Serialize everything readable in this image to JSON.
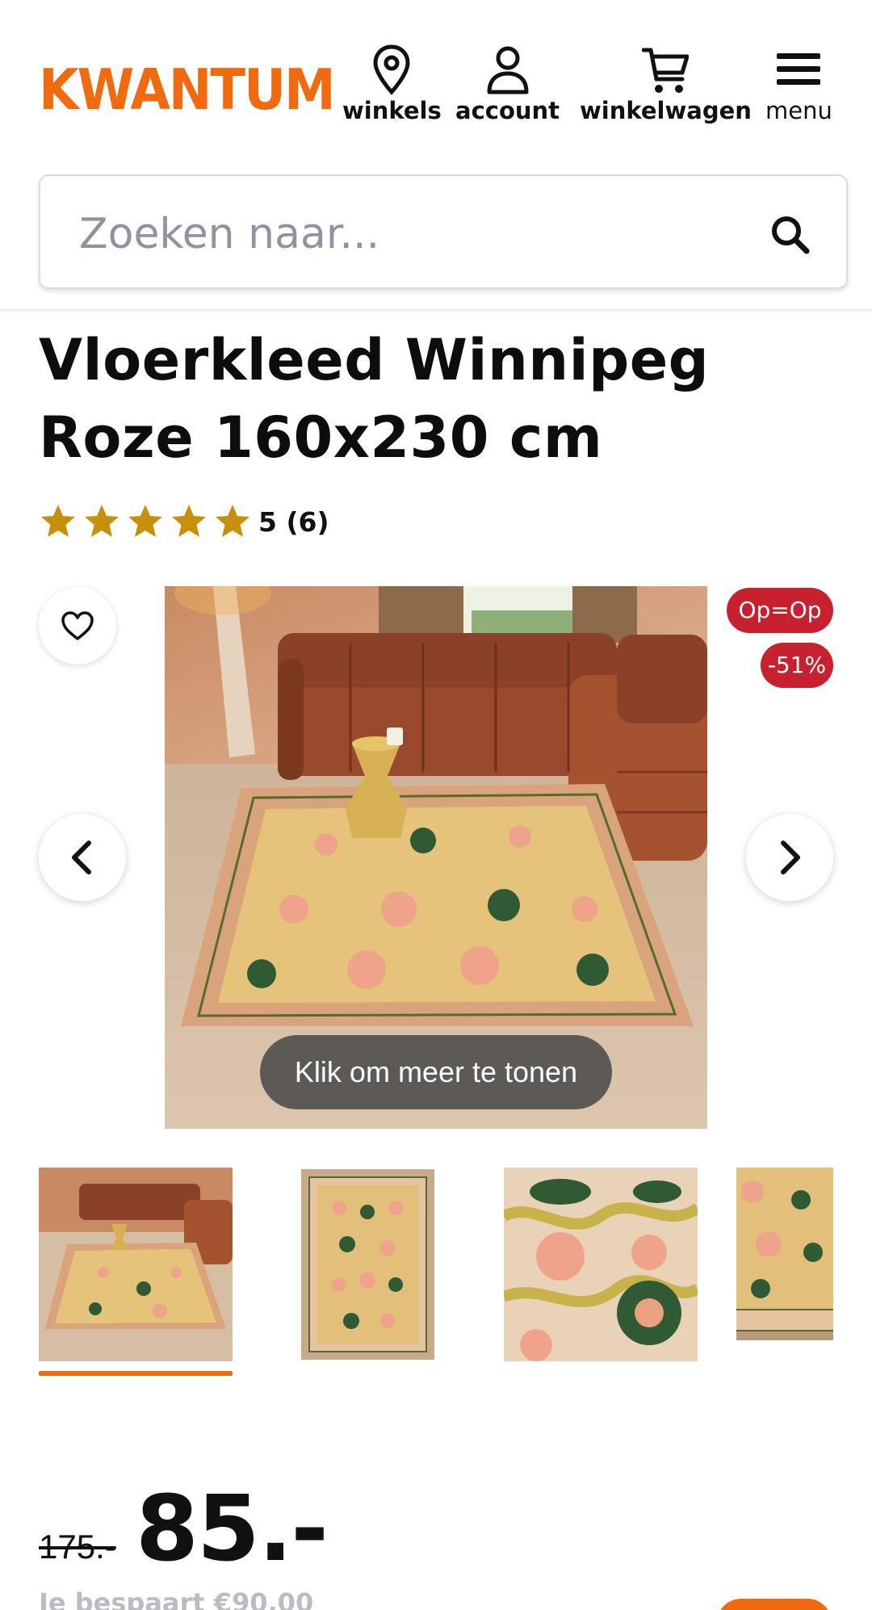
{
  "brand": {
    "logo_text": "KWANTUM",
    "accent_color": "#f26a10"
  },
  "nav": {
    "winkels": {
      "label": "winkels",
      "icon": "map-pin-icon"
    },
    "account": {
      "label": "account",
      "icon": "user-icon"
    },
    "cart": {
      "label": "winkelwagen",
      "icon": "shopping-cart-icon"
    },
    "menu": {
      "label": "menu",
      "icon": "hamburger-menu-icon"
    }
  },
  "search": {
    "placeholder": "Zoeken naar...",
    "value": "",
    "icon": "search-icon"
  },
  "product": {
    "title": "Vloerkleed Winnipeg Roze 160x230 cm",
    "rating": {
      "stars": 5,
      "max_stars": 5,
      "text": "5 (6)",
      "star_color": "#c8900a"
    },
    "badges": {
      "offer": "Op=Op",
      "discount": "-51%",
      "badge_color": "#c7202e"
    },
    "gallery": {
      "overlay_text": "Klik om meer te tonen",
      "thumbnail_count": 4,
      "active_thumbnail": 1
    },
    "price": {
      "old": "175.-",
      "new": "85.-",
      "savings": "Je bespaart €90,00"
    }
  }
}
